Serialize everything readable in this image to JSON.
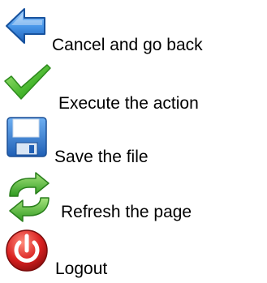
{
  "actions": [
    {
      "label": "Cancel and go back",
      "icon": "back-arrow-icon",
      "color": "#2f7fd8"
    },
    {
      "label": "Execute the action",
      "icon": "checkmark-icon",
      "color": "#3fae2a"
    },
    {
      "label": "Save the file",
      "icon": "floppy-disk-icon",
      "color": "#2c6fc8"
    },
    {
      "label": "Refresh the page",
      "icon": "refresh-arrows-icon",
      "color": "#43b02a"
    },
    {
      "label": "Logout",
      "icon": "power-icon",
      "color": "#d21f1f"
    }
  ]
}
